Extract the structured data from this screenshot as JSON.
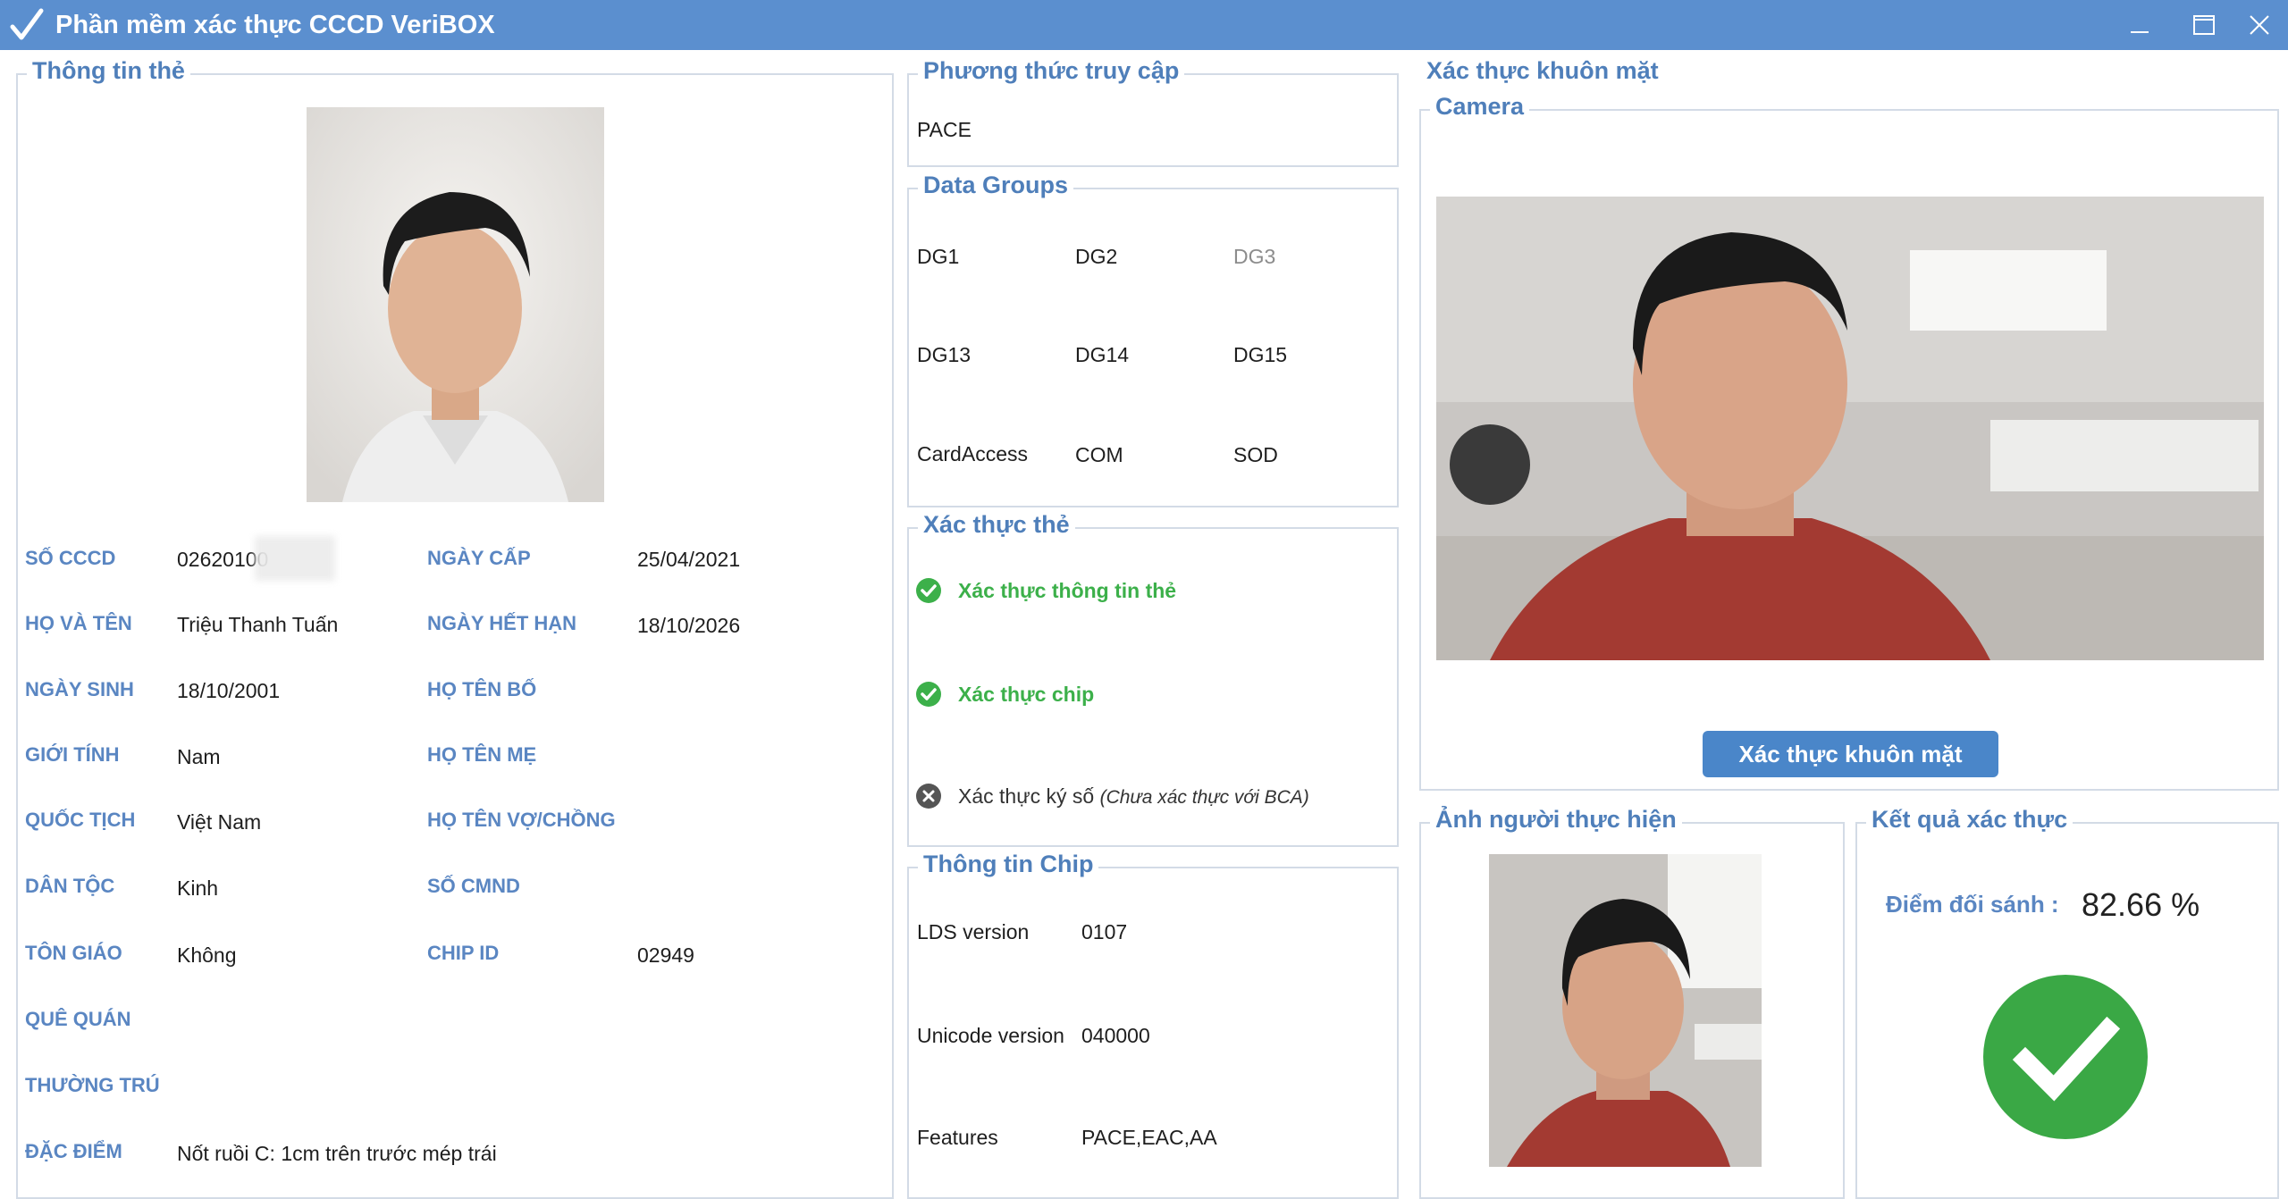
{
  "window": {
    "title": "Phần mềm xác thực CCCD VeriBOX"
  },
  "card_info": {
    "title": "Thông tin thẻ",
    "fields_left": [
      {
        "label": "SỐ CCCD",
        "value": "02620100"
      },
      {
        "label": "HỌ VÀ TÊN",
        "value": "Triệu Thanh Tuấn"
      },
      {
        "label": "NGÀY SINH",
        "value": "18/10/2001"
      },
      {
        "label": "GIỚI TÍNH",
        "value": "Nam"
      },
      {
        "label": "QUỐC TỊCH",
        "value": "Việt Nam"
      },
      {
        "label": "DÂN TỘC",
        "value": "Kinh"
      },
      {
        "label": "TÔN GIÁO",
        "value": "Không"
      },
      {
        "label": "QUÊ QUÁN",
        "value": ""
      },
      {
        "label": "THƯỜNG TRÚ",
        "value": ""
      },
      {
        "label": "ĐẶC ĐIỂM",
        "value": "Nốt ruồi C: 1cm trên trước mép trái"
      }
    ],
    "fields_right": [
      {
        "label": "NGÀY CẤP",
        "value": "25/04/2021"
      },
      {
        "label": "NGÀY HẾT HẠN",
        "value": "18/10/2026"
      },
      {
        "label": "HỌ TÊN BỐ",
        "value": ""
      },
      {
        "label": "HỌ TÊN MẸ",
        "value": ""
      },
      {
        "label": "HỌ TÊN VỢ/CHỒNG",
        "value": ""
      },
      {
        "label": "SỐ CMND",
        "value": ""
      },
      {
        "label": "CHIP ID",
        "value": "02949"
      }
    ]
  },
  "access_method": {
    "title": "Phương thức truy cập",
    "value": "PACE"
  },
  "data_groups": {
    "title": "Data Groups",
    "items": [
      {
        "name": "DG1",
        "enabled": true
      },
      {
        "name": "DG2",
        "enabled": true
      },
      {
        "name": "DG3",
        "enabled": false
      },
      {
        "name": "DG13",
        "enabled": true
      },
      {
        "name": "DG14",
        "enabled": true
      },
      {
        "name": "DG15",
        "enabled": true
      },
      {
        "name": "CardAccess",
        "enabled": true
      },
      {
        "name": "COM",
        "enabled": true
      },
      {
        "name": "SOD",
        "enabled": true
      }
    ]
  },
  "card_verify": {
    "title": "Xác thực thẻ",
    "checks": [
      {
        "label": "Xác thực thông tin thẻ",
        "status": "ok",
        "icon": "check-circle-icon"
      },
      {
        "label": "Xác thực chip",
        "status": "ok",
        "icon": "check-circle-icon"
      },
      {
        "label": "Xác thực ký số",
        "note": "(Chưa xác thực với BCA)",
        "status": "fail",
        "icon": "x-circle-icon"
      }
    ]
  },
  "chip_info": {
    "title": "Thông tin Chip",
    "rows": [
      {
        "label": "LDS version",
        "value": "0107"
      },
      {
        "label": "Unicode version",
        "value": "040000"
      },
      {
        "label": "Features",
        "value": "PACE,EAC,AA"
      }
    ]
  },
  "face_verify": {
    "title": "Xác thực khuôn mặt",
    "camera_title": "Camera",
    "button_label": "Xác thực khuôn mặt"
  },
  "performer": {
    "title": "Ảnh người thực hiện"
  },
  "result": {
    "title": "Kết quả xác thực",
    "score_label": "Điểm đối sánh :",
    "score_value": "82.66 %",
    "status": "success",
    "colors": {
      "success": "#3aa845",
      "accent": "#4f7fba"
    }
  }
}
